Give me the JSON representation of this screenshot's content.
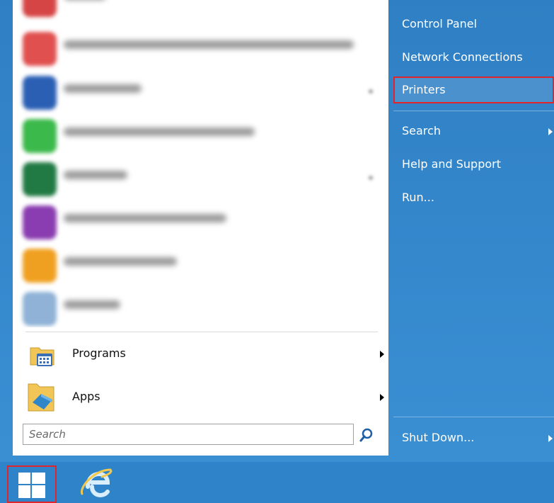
{
  "start_menu": {
    "programs_label": "Programs",
    "apps_label": "Apps",
    "search_placeholder": "Search",
    "recent_apps": [
      {
        "name": "app-1",
        "color": "#d64545",
        "text_width": 60
      },
      {
        "name": "app-2",
        "color": "#e0504f",
        "text_width": 410
      },
      {
        "name": "app-3",
        "color": "#2b5fb4",
        "text_width": 110,
        "arrow": true
      },
      {
        "name": "app-4",
        "color": "#3bb94a",
        "text_width": 270
      },
      {
        "name": "app-5",
        "color": "#217a43",
        "text_width": 90,
        "arrow": true
      },
      {
        "name": "app-6",
        "color": "#8a3db0",
        "text_width": 230
      },
      {
        "name": "app-7",
        "color": "#f0a020",
        "text_width": 160
      },
      {
        "name": "app-8",
        "color": "#8fb2d6",
        "text_width": 80
      }
    ]
  },
  "right_panel": {
    "items": {
      "control_panel": "Control Panel",
      "network_connections": "Network Connections",
      "printers": "Printers",
      "search": "Search",
      "help_and_support": "Help and Support",
      "run": "Run...",
      "shut_down": "Shut Down..."
    }
  },
  "colors": {
    "accent_red": "#e0262c",
    "panel_blue": "#2f83c8"
  }
}
